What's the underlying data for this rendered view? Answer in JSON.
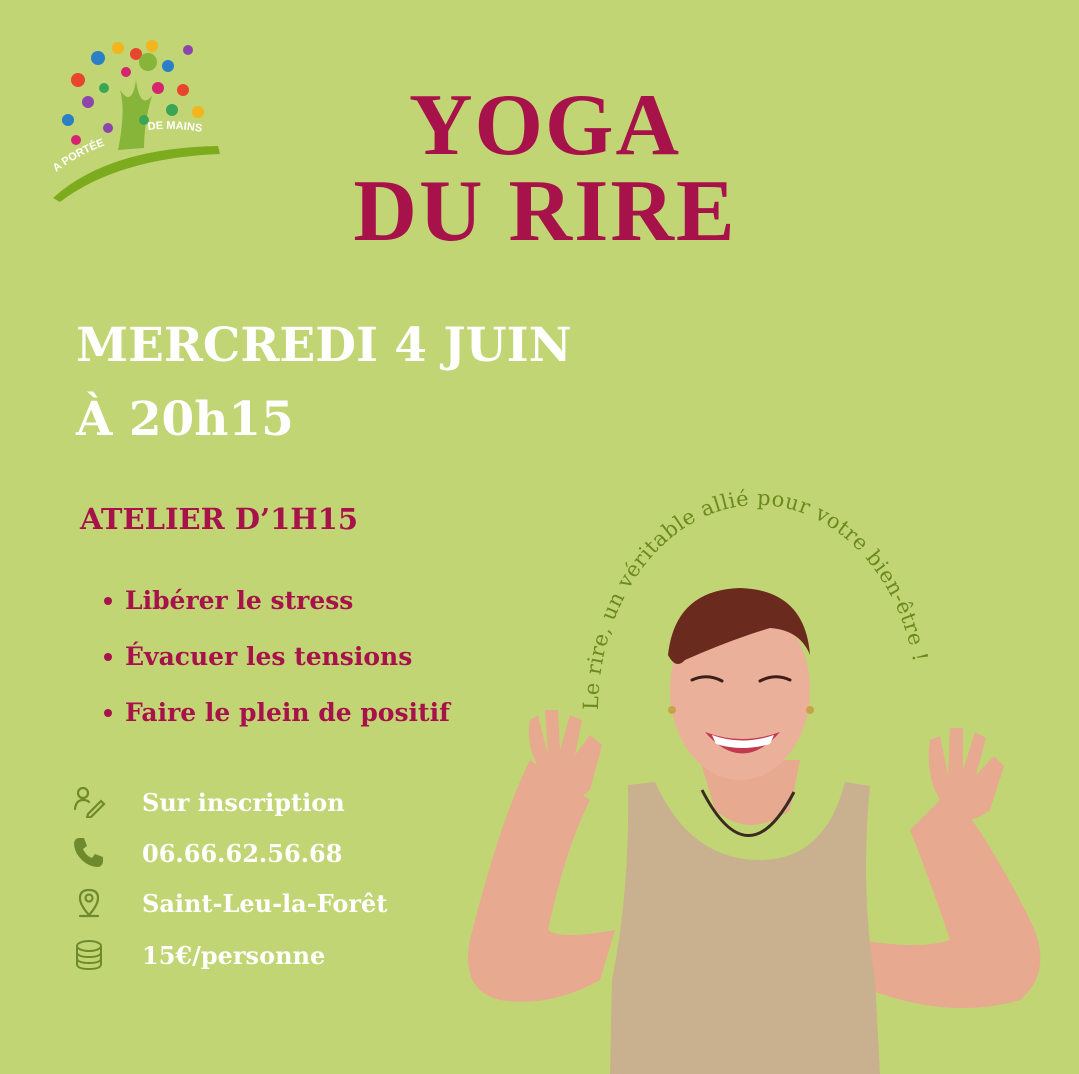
{
  "logo": {
    "top_text": "A PORTÉE",
    "right_text": "DE MAINS"
  },
  "title": {
    "line1": "YOGA",
    "line2": "DU RIRE"
  },
  "date": {
    "line1": "MERCREDI 4 JUIN",
    "line2": "À 20h15"
  },
  "duration": "ATELIER D’1H15",
  "benefits": [
    "Libérer le stress",
    "Évacuer les tensions",
    "Faire le plein de positif"
  ],
  "info": [
    {
      "icon": "sign-up-icon",
      "text": "Sur inscription"
    },
    {
      "icon": "phone-icon",
      "text": "06.66.62.56.68"
    },
    {
      "icon": "location-pin-icon",
      "text": "Saint-Leu-la-Forêt"
    },
    {
      "icon": "coins-icon",
      "text": "15€/personne"
    }
  ],
  "arc_text": "Le rire, un véritable allié  pour votre bien-être !",
  "colors": {
    "background": "#c2d574",
    "accent": "#a8124a",
    "text_light": "#ffffff",
    "arc_text": "#6b8a1e",
    "icon": "#6e8a2c"
  }
}
